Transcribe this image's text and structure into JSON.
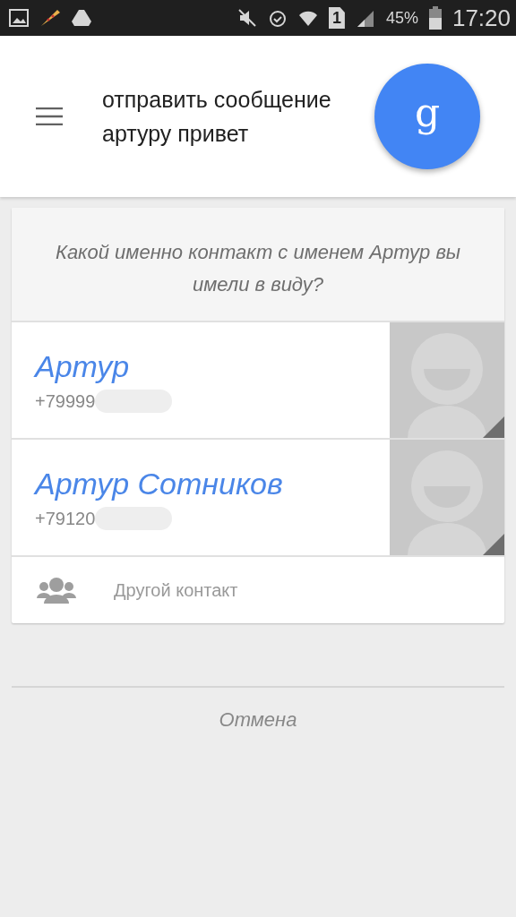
{
  "status_bar": {
    "sim_slot": "1",
    "battery": "45%",
    "time": "17:20"
  },
  "query": {
    "text": "отправить сообщение артуру привет",
    "logo": "g"
  },
  "prompt": "Какой именно контакт с именем Артур вы имели в виду?",
  "contacts": [
    {
      "name": "Артур",
      "phone": "+79999"
    },
    {
      "name": "Артур Сотников",
      "phone": "+79120"
    }
  ],
  "other_contact": "Другой контакт",
  "cancel": "Отмена"
}
